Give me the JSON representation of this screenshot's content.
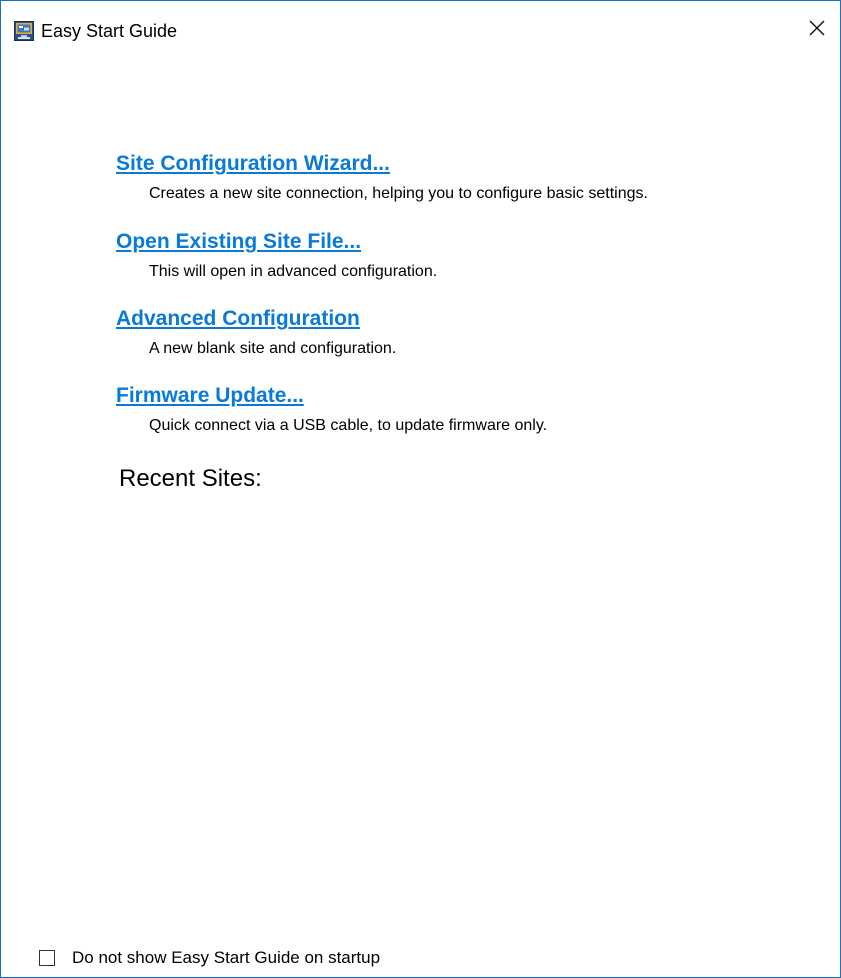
{
  "window": {
    "title": "Easy Start Guide",
    "app_icon": "monitor-app-icon",
    "close_icon": "close-icon"
  },
  "options": [
    {
      "link": "Site Configuration Wizard...",
      "description": "Creates a new site connection, helping you to configure basic settings."
    },
    {
      "link": "Open Existing Site File...",
      "description": "This will open in advanced configuration."
    },
    {
      "link": "Advanced Configuration",
      "description": "A new blank site and configuration."
    },
    {
      "link": "Firmware Update...",
      "description": "Quick connect via a USB cable, to update firmware only."
    }
  ],
  "recent_sites": {
    "heading": "Recent Sites:",
    "items": []
  },
  "footer": {
    "checkbox_label": "Do not show Easy Start Guide on startup",
    "checked": false
  },
  "colors": {
    "link": "#0a7ad8",
    "window_border": "#1a73c4"
  }
}
